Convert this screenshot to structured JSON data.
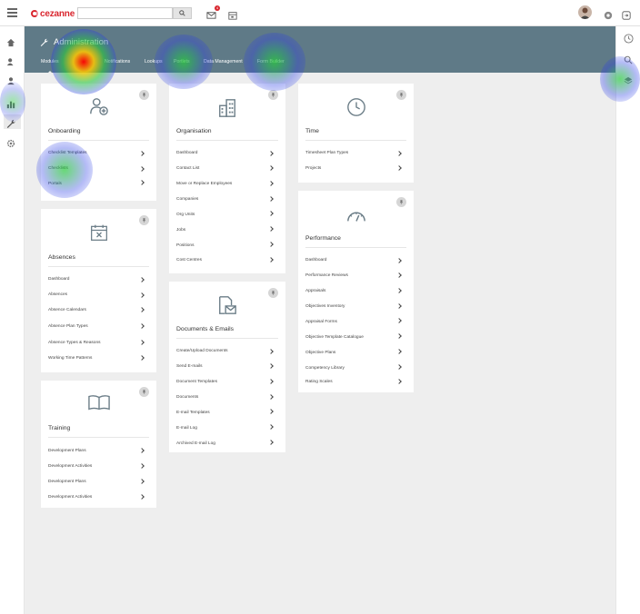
{
  "topbar": {
    "logo": "cezanne",
    "search_placeholder": "",
    "notification_count": "4"
  },
  "header": {
    "title": "Administration",
    "tabs": [
      "Modules",
      "Notifications",
      "Lookups",
      "Portlets",
      "Data Management",
      "Form Builder"
    ],
    "active_tab": "Modules"
  },
  "cards": {
    "onboarding": {
      "title": "Onboarding",
      "links": [
        "Checklist Templates",
        "Checklists",
        "Portals"
      ]
    },
    "absences": {
      "title": "Absences",
      "links": [
        "Dashboard",
        "Absences",
        "Absence Calendars",
        "Absence Plan Types",
        "Absence Types & Reasons",
        "Working Time Patterns"
      ]
    },
    "training": {
      "title": "Training",
      "links": [
        "Development Plans",
        "Development Activities",
        "Development Plans",
        "Development Activities"
      ]
    },
    "organisation": {
      "title": "Organisation",
      "links": [
        "Dashboard",
        "Contact List",
        "Move or Replace Employees",
        "Companies",
        "Org Units",
        "Jobs",
        "Positions",
        "Cost Centres"
      ]
    },
    "documents": {
      "title": "Documents & Emails",
      "links": [
        "Create/Upload Documents",
        "Send E-mails",
        "Document Templates",
        "Documents",
        "E-mail Templates",
        "E-mail Log",
        "Archived E-mail Log"
      ]
    },
    "time": {
      "title": "Time",
      "links": [
        "Timesheet Plan Types",
        "Projects"
      ]
    },
    "performance": {
      "title": "Performance",
      "links": [
        "Dashboard",
        "Performance Reviews",
        "Appraisals",
        "Objectives Inventory",
        "Appraisal Forms",
        "Objective Template Catalogue",
        "Objective Plans",
        "Competency Library",
        "Rating Scales"
      ]
    }
  },
  "colors": {
    "accent": "#d9262e",
    "header_band": "#5f7a87",
    "icon": "#6b7d87"
  }
}
